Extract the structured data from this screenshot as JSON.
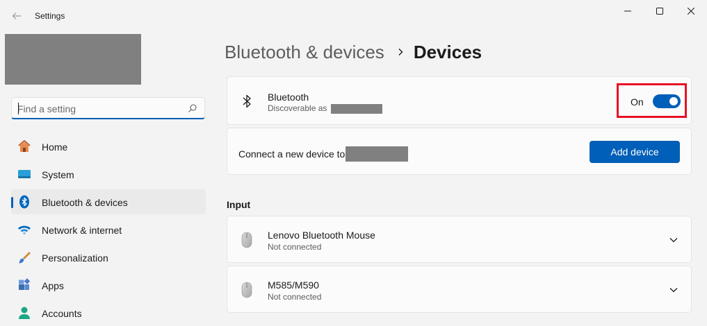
{
  "window": {
    "app_title": "Settings",
    "controls": [
      "minimize",
      "maximize",
      "close"
    ]
  },
  "sidebar": {
    "search": {
      "placeholder": "Find a setting",
      "value": ""
    },
    "items": [
      {
        "label": "Home",
        "icon": "home-icon",
        "active": false
      },
      {
        "label": "System",
        "icon": "system-icon",
        "active": false
      },
      {
        "label": "Bluetooth & devices",
        "icon": "bluetooth-icon",
        "active": true
      },
      {
        "label": "Network & internet",
        "icon": "wifi-icon",
        "active": false
      },
      {
        "label": "Personalization",
        "icon": "brush-icon",
        "active": false
      },
      {
        "label": "Apps",
        "icon": "apps-icon",
        "active": false
      },
      {
        "label": "Accounts",
        "icon": "accounts-icon",
        "active": false
      }
    ]
  },
  "main": {
    "breadcrumb": {
      "parent": "Bluetooth & devices",
      "current": "Devices"
    },
    "bluetooth": {
      "title": "Bluetooth",
      "subtitle": "Discoverable as",
      "toggle_label": "On",
      "toggle_on": true
    },
    "connect": {
      "text": "Connect a new device to",
      "button_label": "Add device"
    },
    "input_section": {
      "title": "Input",
      "devices": [
        {
          "name": "Lenovo Bluetooth Mouse",
          "status": "Not connected",
          "icon": "mouse-icon"
        },
        {
          "name": "M585/M590",
          "status": "Not connected",
          "icon": "mouse-icon"
        }
      ]
    }
  },
  "colors": {
    "accent": "#005fb8",
    "highlight": "#e81123",
    "background": "#f3f3f3",
    "card": "#fbfbfb"
  }
}
